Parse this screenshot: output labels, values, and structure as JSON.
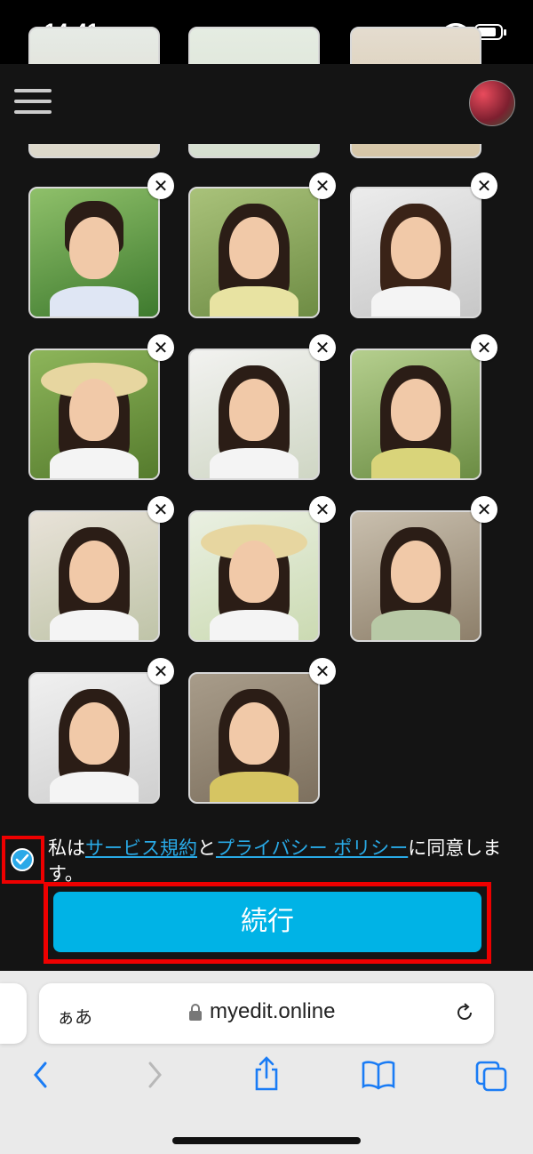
{
  "status_bar": {
    "time": "14:41"
  },
  "header": {
    "menu_icon": "hamburger-icon",
    "avatar_icon": "avatar"
  },
  "gallery": {
    "remove_icon_glyph": "✕",
    "photos": [
      {
        "label": "man-smiling-park"
      },
      {
        "label": "woman-long-hair-garden"
      },
      {
        "label": "woman-gray-background"
      },
      {
        "label": "woman-straw-hat"
      },
      {
        "label": "woman-hair-flowing"
      },
      {
        "label": "woman-ruffle-top-outdoor"
      },
      {
        "label": "woman-arms-raised"
      },
      {
        "label": "woman-straw-hat-2"
      },
      {
        "label": "woman-earrings-outdoor"
      },
      {
        "label": "woman-laughing-hair-windblown"
      },
      {
        "label": "girl-pointing-yellow-sweater"
      }
    ]
  },
  "consent": {
    "text_prefix": "私は",
    "terms_link": "サービス規約",
    "and": "と",
    "privacy_link": "プライバシー ポリシー",
    "text_suffix": "に同意します。",
    "checked": true
  },
  "continue_button": {
    "label": "続行"
  },
  "browser": {
    "aa_label": "ぁあ",
    "url": "myedit.online"
  },
  "colors": {
    "accent": "#00b3e6",
    "link": "#29a9e5",
    "highlight": "#e00000",
    "background": "#141414"
  }
}
